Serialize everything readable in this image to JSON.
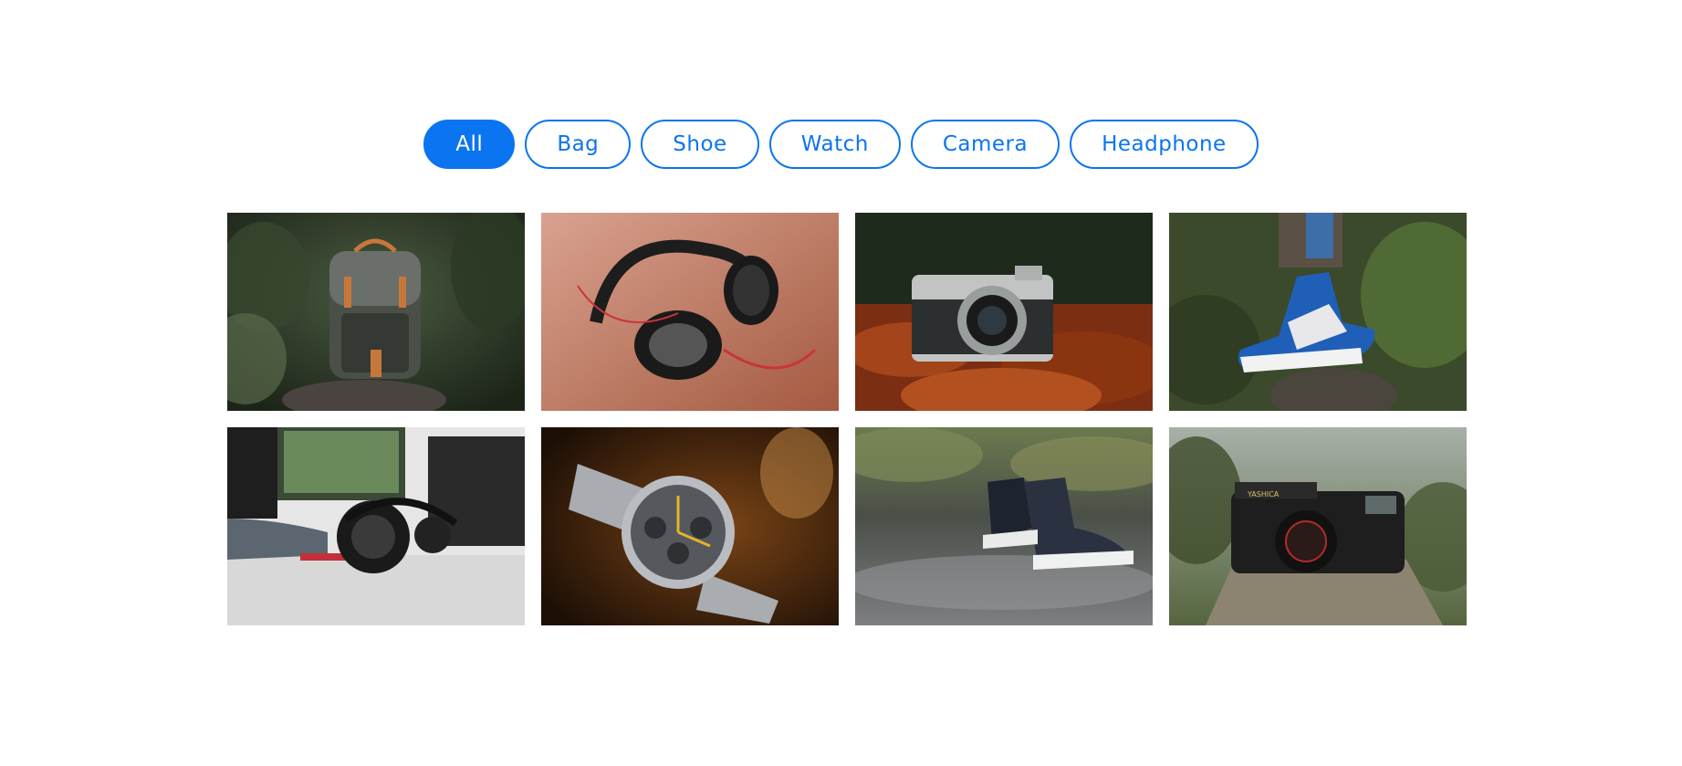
{
  "filters": [
    {
      "label": "All",
      "active": true
    },
    {
      "label": "Bag"
    },
    {
      "label": "Shoe"
    },
    {
      "label": "Watch"
    },
    {
      "label": "Camera"
    },
    {
      "label": "Headphone"
    }
  ],
  "gallery": [
    {
      "category": "Bag",
      "subject": "backpack",
      "colors": {
        "bg": "#2f3a2c",
        "accent": "#c7773a"
      }
    },
    {
      "category": "Headphone",
      "subject": "headphones",
      "colors": {
        "bg": "#b66a56",
        "accent": "#c9343c"
      }
    },
    {
      "category": "Camera",
      "subject": "camera",
      "colors": {
        "bg": "#7c2e12",
        "accent": "#3a3f3f"
      }
    },
    {
      "category": "Shoe",
      "subject": "sneaker",
      "colors": {
        "bg": "#3b4a2a",
        "accent": "#1f5fb8"
      }
    },
    {
      "category": "Headphone",
      "subject": "headphones-desk",
      "colors": {
        "bg": "#dcdcdc",
        "accent": "#1a1a1a"
      }
    },
    {
      "category": "Watch",
      "subject": "watch",
      "colors": {
        "bg": "#3a2210",
        "accent": "#a9acb0"
      }
    },
    {
      "category": "Shoe",
      "subject": "sneakers-water",
      "colors": {
        "bg": "#596051",
        "accent": "#1d2430"
      }
    },
    {
      "category": "Camera",
      "subject": "vintage-camera",
      "colors": {
        "bg": "#5c6b4a",
        "accent": "#222222"
      }
    }
  ],
  "yashica_label": "YASHICA"
}
